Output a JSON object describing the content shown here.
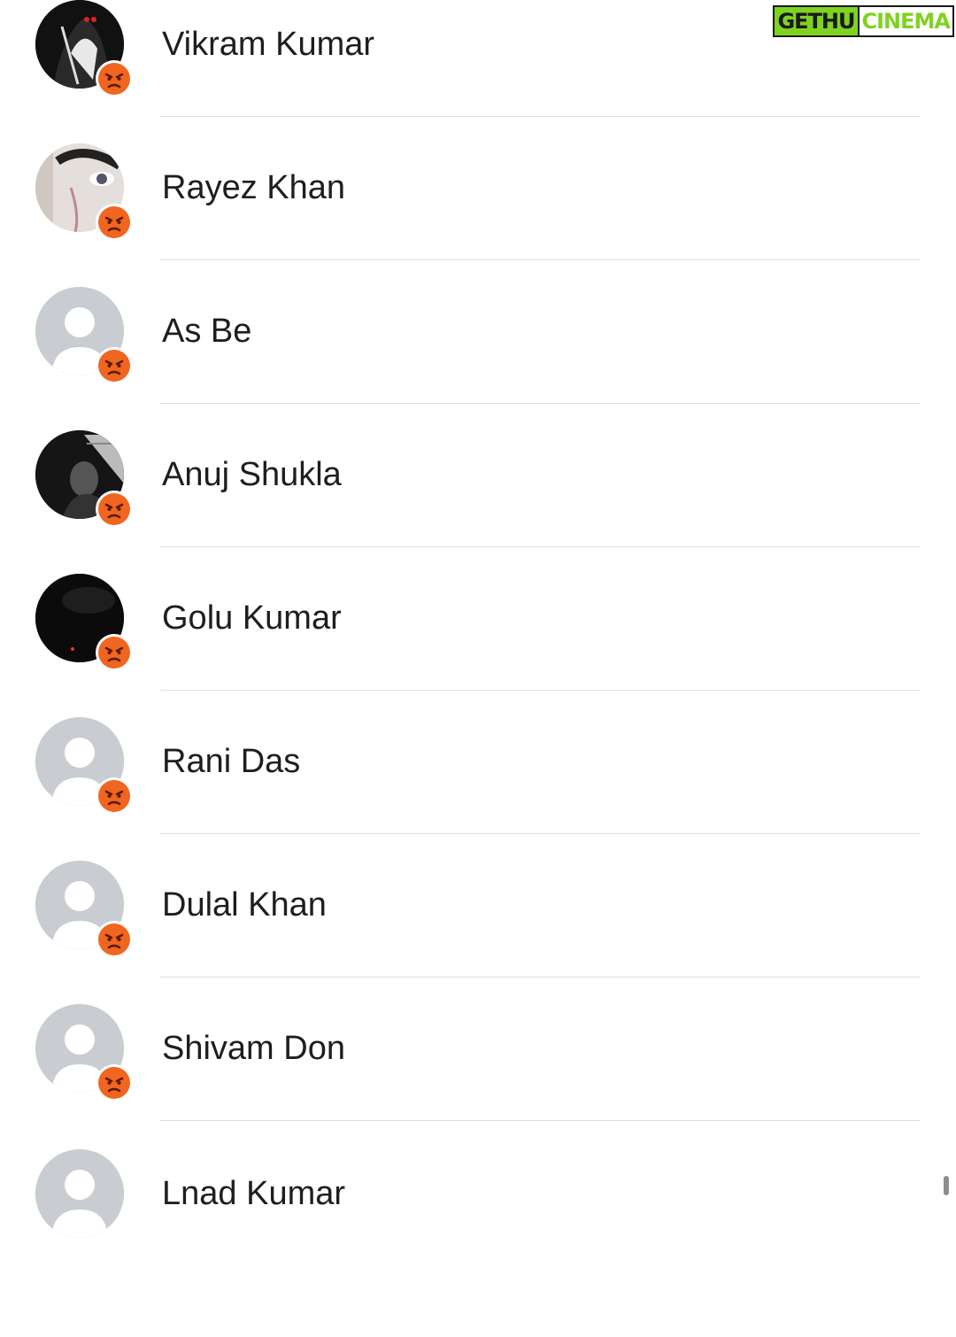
{
  "watermark": {
    "left": "GETHU",
    "right": "CINEMA"
  },
  "contacts": [
    {
      "name": "Vikram Kumar",
      "avatar": "photo-dark-hooded",
      "reaction": "angry-emoji-icon"
    },
    {
      "name": "Rayez Khan",
      "avatar": "photo-face-closeup",
      "reaction": "angry-emoji-icon"
    },
    {
      "name": "As Be",
      "avatar": "default-avatar",
      "reaction": "angry-emoji-icon"
    },
    {
      "name": "Anuj Shukla",
      "avatar": "photo-dark-portrait",
      "reaction": "angry-emoji-icon"
    },
    {
      "name": "Golu Kumar",
      "avatar": "photo-dark",
      "reaction": "angry-emoji-icon"
    },
    {
      "name": "Rani Das",
      "avatar": "default-avatar",
      "reaction": "angry-emoji-icon"
    },
    {
      "name": "Dulal Khan",
      "avatar": "default-avatar",
      "reaction": "angry-emoji-icon"
    },
    {
      "name": "Shivam Don",
      "avatar": "default-avatar",
      "reaction": "angry-emoji-icon"
    },
    {
      "name": "Lnad Kumar",
      "avatar": "default-avatar",
      "reaction": "none"
    }
  ],
  "colors": {
    "reaction_orange": "#f0651f",
    "divider": "#dadde1",
    "default_avatar": "#c9ccd1"
  }
}
